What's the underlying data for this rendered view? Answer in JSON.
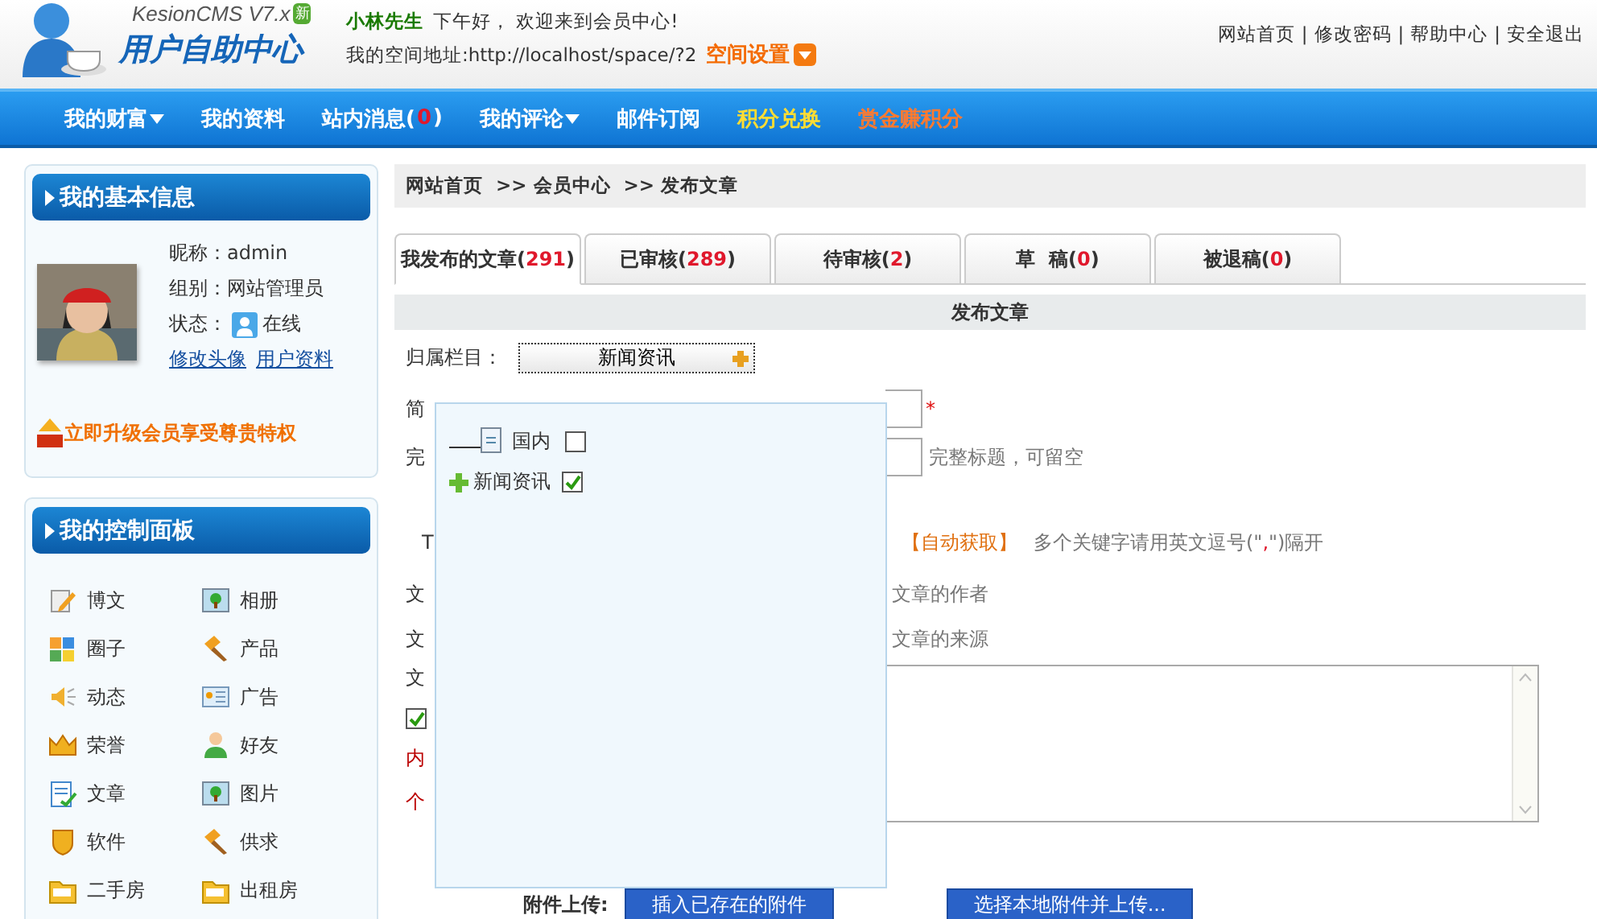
{
  "header": {
    "brand": "KesionCMS V7.x",
    "badge": "新",
    "title": "用户自助中心",
    "user": "小林先生",
    "greeting": "下午好， 欢迎来到会员中心!",
    "space_address": "我的空间地址:http://localhost/space/?2",
    "space_settings": "空间设置",
    "links": [
      "网站首页",
      "修改密码",
      "帮助中心",
      "安全退出"
    ],
    "separator": "|"
  },
  "nav": [
    {
      "label": "我的财富",
      "dropdown": true,
      "kind": "normal"
    },
    {
      "label": "我的资料",
      "dropdown": false,
      "kind": "normal"
    },
    {
      "label": "站内消息(",
      "count": "0",
      "suffix": ")",
      "dropdown": false,
      "kind": "normal"
    },
    {
      "label": "我的评论",
      "dropdown": true,
      "kind": "normal"
    },
    {
      "label": "邮件订阅",
      "dropdown": false,
      "kind": "normal"
    },
    {
      "label": "积分兑换",
      "dropdown": false,
      "kind": "highlight"
    },
    {
      "label": "赏金赚积分",
      "dropdown": false,
      "kind": "alert"
    }
  ],
  "sidebar": {
    "info_panel": {
      "title": "我的基本信息",
      "avatar": {
        "kind": "picture"
      },
      "nickname": "昵称：admin",
      "group": "组别：网站管理员",
      "status_label": "状态：",
      "status": "在线",
      "links": [
        "修改头像",
        "用户资料"
      ],
      "vip": "立即升级会员享受尊贵特权"
    },
    "control_panel": {
      "title": "我的控制面板",
      "items": [
        {
          "label": "博文",
          "kind": "pencil"
        },
        {
          "label": "相册"
        },
        {
          "label": "圈子",
          "kind": "tiles"
        },
        {
          "label": "产品",
          "kind": "hammer"
        },
        {
          "label": "动态",
          "kind": "speaker"
        },
        {
          "label": "广告",
          "kind": "card"
        },
        {
          "label": "荣誉",
          "kind": "crown"
        },
        {
          "label": "好友",
          "kind": "person"
        },
        {
          "label": "文章",
          "kind": "document"
        },
        {
          "label": "图片"
        },
        {
          "label": "软件",
          "kind": "shield"
        },
        {
          "label": "供求",
          "kind": "hammer"
        },
        {
          "label": "二手房",
          "kind": "folder"
        },
        {
          "label": "出租房",
          "kind": "folder"
        }
      ]
    }
  },
  "breadcrumb": [
    "网站首页",
    ">> 会员中心",
    ">> 发布文章"
  ],
  "tabs": [
    {
      "label": "我发布的文章(",
      "count": "291",
      "suffix": ")",
      "selected": true
    },
    {
      "label": "已审核(",
      "count": "289",
      "suffix": ")",
      "selected": false
    },
    {
      "label": "待审核(",
      "count": "2",
      "suffix": ")",
      "selected": false
    },
    {
      "label": "草  稿(",
      "count": "0",
      "suffix": ")",
      "selected": false
    },
    {
      "label": "被退稿(",
      "count": "0",
      "suffix": ")",
      "selected": false
    }
  ],
  "form": {
    "heading": "发布文章",
    "category_label": "归属栏目：",
    "category_value": "新闻资讯",
    "rows": [
      {
        "kind": "input",
        "label": "简",
        "required": "*"
      },
      {
        "kind": "input",
        "label": "完",
        "hint": "完整标题，可留空"
      },
      {
        "kind": "keywords",
        "label": "T",
        "action": "【自动获取】",
        "hint_before": "多个关键字请用英文逗号(\"",
        "hint_mark": ",",
        "hint_after": "\")隔开"
      },
      {
        "kind": "text",
        "label": "文",
        "hint": "文章的作者"
      },
      {
        "kind": "text",
        "label": "文",
        "hint": "文章的来源"
      }
    ],
    "content_label": "文",
    "content_checked": true,
    "content_notes": [
      "内",
      "个"
    ],
    "attachment_label": "附件上传:",
    "attachment_buttons": [
      "插入已存在的附件",
      "选择本地附件并上传..."
    ]
  },
  "dropdown": {
    "items": [
      {
        "label": "国内",
        "kind": "leaf",
        "checked": false
      },
      {
        "label": "新闻资讯",
        "kind": "root",
        "checked": true
      }
    ]
  }
}
